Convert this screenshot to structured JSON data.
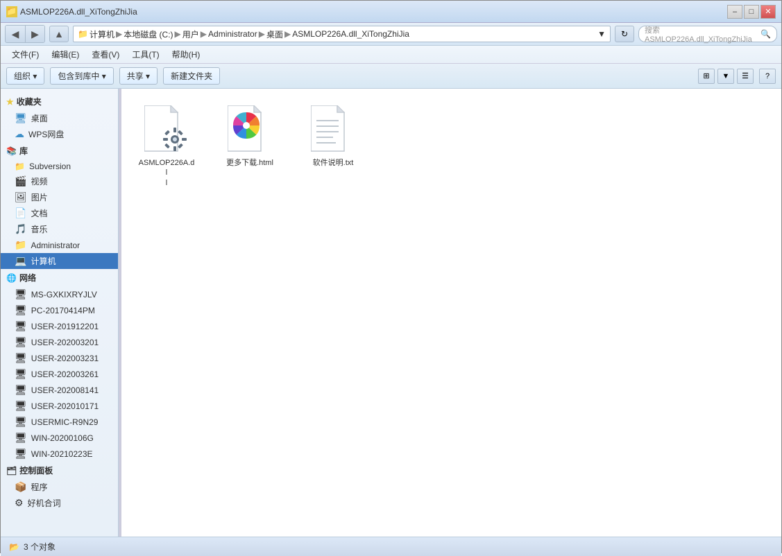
{
  "titleBar": {
    "title": "ASMLOP226A.dll_XiTongZhiJia",
    "minimize": "–",
    "maximize": "□",
    "close": "✕"
  },
  "addressBar": {
    "breadcrumbs": [
      "计算机",
      "本地磁盘 (C:)",
      "用户",
      "Administrator",
      "桌面",
      "ASMLOP226A.dll_XiTongZhiJia"
    ],
    "searchPlaceholder": "搜索 ASMLOP226A.dll_XiTongZhiJia"
  },
  "menuBar": {
    "items": [
      "文件(F)",
      "编辑(E)",
      "查看(V)",
      "工具(T)",
      "帮助(H)"
    ]
  },
  "toolbar": {
    "organize": "组织 ▾",
    "library": "包含到库中 ▾",
    "share": "共享 ▾",
    "newFolder": "新建文件夹"
  },
  "sidebar": {
    "favorites": {
      "label": "收藏夹",
      "items": [
        "桌面"
      ]
    },
    "wps": "WPS网盘",
    "library": {
      "label": "库",
      "items": [
        "Subversion",
        "视频",
        "图片",
        "文档",
        "音乐"
      ]
    },
    "administrator": "Administrator",
    "computer": "计算机",
    "network": {
      "label": "网络",
      "items": [
        "MS-GXKIXRYJLV",
        "PC-20170414PM",
        "USER-201912201",
        "USER-202003201",
        "USER-202003231",
        "USER-202003261",
        "USER-202008141",
        "USER-202010171",
        "USERMIC-R9N29",
        "WIN-20200106G",
        "WIN-20210223E"
      ]
    },
    "controlPanel": {
      "label": "控制面板",
      "items": [
        "程序",
        "好机合词"
      ]
    }
  },
  "files": [
    {
      "name": "ASMLOP226A.dll",
      "type": "dll",
      "label": "ASMLOP226A.dl\nl"
    },
    {
      "name": "更多下载.html",
      "type": "html",
      "label": "更多下载.html"
    },
    {
      "name": "软件说明.txt",
      "type": "txt",
      "label": "软件说明.txt"
    }
  ],
  "statusBar": {
    "count": "3 个对象",
    "icon": "🗂"
  }
}
